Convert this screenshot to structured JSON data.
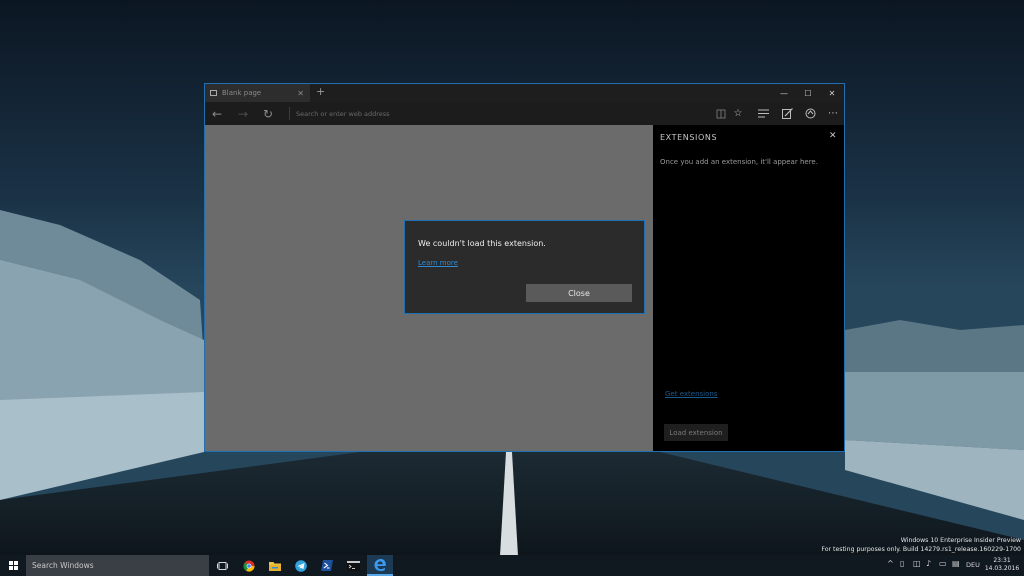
{
  "browser": {
    "tab_title": "Blank page",
    "tab_close": "✕",
    "new_tab": "+",
    "window_controls": {
      "minimize": "—",
      "maximize": "☐",
      "close": "✕"
    },
    "nav": {
      "back": "←",
      "forward": "→",
      "refresh": "↻"
    },
    "address_placeholder": "Search or enter web address",
    "toolbar_icons": [
      "reading-view-icon",
      "favorite-icon",
      "hub-icon",
      "web-note-icon",
      "share-icon",
      "more-icon"
    ]
  },
  "extensions_panel": {
    "title": "EXTENSIONS",
    "close": "✕",
    "description": "Once you add an extension, it'll appear here.",
    "get_link": "Get extensions",
    "load_button": "Load extension"
  },
  "dialog": {
    "message": "We couldn't load this extension.",
    "learn_more": "Learn more",
    "close_button": "Close"
  },
  "watermark": {
    "line1": "Windows 10 Enterprise Insider Preview",
    "line2": "For testing purposes only. Build 14279.rs1_release.160229-1700"
  },
  "taskbar": {
    "search_placeholder": "Search Windows",
    "apps": [
      "task-view-icon",
      "chrome-icon",
      "file-explorer-icon",
      "telegram-icon",
      "powershell-icon",
      "cmd-icon",
      "edge-icon"
    ],
    "language": "DEU",
    "time": "23:31",
    "date": "14.03.2016"
  },
  "colors": {
    "accent": "#1f6fb2",
    "link": "#2d8bd6",
    "content_bg": "#6b6b6b",
    "panel_bg": "#000000"
  }
}
